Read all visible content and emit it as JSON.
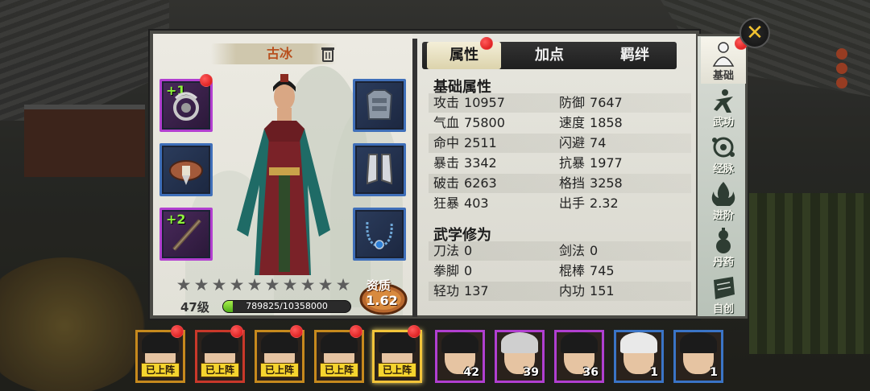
{
  "character": {
    "name": "古冰",
    "level": "47级",
    "exp_text": "789825/10358000",
    "exp_progress": 0.076,
    "stars_total": 10,
    "stars_filled": 0,
    "quality_label": "资质",
    "quality_value": "1.62"
  },
  "equipment": [
    {
      "plus": "+1",
      "icon": "accessory-icon"
    },
    {
      "plus": "",
      "icon": "armor-icon"
    },
    {
      "plus": "",
      "icon": "belt-icon"
    },
    {
      "plus": "",
      "icon": "boots-icon"
    },
    {
      "plus": "+2",
      "icon": "staff-weapon-icon"
    },
    {
      "plus": "",
      "icon": "necklace-icon"
    }
  ],
  "tabs": [
    {
      "label": "属性",
      "active": true
    },
    {
      "label": "加点",
      "active": false
    },
    {
      "label": "羁绊",
      "active": false
    }
  ],
  "base_stats": {
    "title": "基础属性",
    "rows": [
      [
        {
          "k": "攻击",
          "v": "10957"
        },
        {
          "k": "防御",
          "v": "7647"
        }
      ],
      [
        {
          "k": "气血",
          "v": "75800"
        },
        {
          "k": "速度",
          "v": "1858"
        }
      ],
      [
        {
          "k": "命中",
          "v": "2511"
        },
        {
          "k": "闪避",
          "v": "74"
        }
      ],
      [
        {
          "k": "暴击",
          "v": "3342"
        },
        {
          "k": "抗暴",
          "v": "1977"
        }
      ],
      [
        {
          "k": "破击",
          "v": "6263"
        },
        {
          "k": "格挡",
          "v": "3258"
        }
      ],
      [
        {
          "k": "狂暴",
          "v": "403"
        },
        {
          "k": "出手",
          "v": "2.32"
        }
      ]
    ]
  },
  "martial_stats": {
    "title": "武学修为",
    "rows": [
      [
        {
          "k": "刀法",
          "v": "0"
        },
        {
          "k": "剑法",
          "v": "0"
        }
      ],
      [
        {
          "k": "拳脚",
          "v": "0"
        },
        {
          "k": "棍棒",
          "v": "745"
        }
      ],
      [
        {
          "k": "轻功",
          "v": "137"
        },
        {
          "k": "内功",
          "v": "151"
        }
      ]
    ]
  },
  "side_nav": [
    {
      "label": "基础",
      "icon": "basic-figure-icon",
      "active": true
    },
    {
      "label": "武功",
      "icon": "martial-arts-icon",
      "active": false
    },
    {
      "label": "经脉",
      "icon": "meridians-icon",
      "active": false
    },
    {
      "label": "进阶",
      "icon": "advance-flame-icon",
      "active": false
    },
    {
      "label": "丹药",
      "icon": "gourd-medicine-icon",
      "active": false
    },
    {
      "label": "自创",
      "icon": "create-scroll-icon",
      "active": false
    }
  ],
  "roster": [
    {
      "tag": "已上阵",
      "num": "",
      "frame": "orange"
    },
    {
      "tag": "已上阵",
      "num": "",
      "frame": "red"
    },
    {
      "tag": "已上阵",
      "num": "",
      "frame": "orange"
    },
    {
      "tag": "已上阵",
      "num": "",
      "frame": "orange"
    },
    {
      "tag": "已上阵",
      "num": "",
      "frame": "gold"
    },
    {
      "tag": "",
      "num": "42",
      "frame": "purple"
    },
    {
      "tag": "",
      "num": "39",
      "frame": "purple"
    },
    {
      "tag": "",
      "num": "36",
      "frame": "purple"
    },
    {
      "tag": "",
      "num": "1",
      "frame": "blue"
    },
    {
      "tag": "",
      "num": "1",
      "frame": "blue"
    }
  ],
  "colors": {
    "accent_orange": "#b8501e",
    "exp_green": "#6fd02a",
    "notify_red": "#d40e0e"
  }
}
